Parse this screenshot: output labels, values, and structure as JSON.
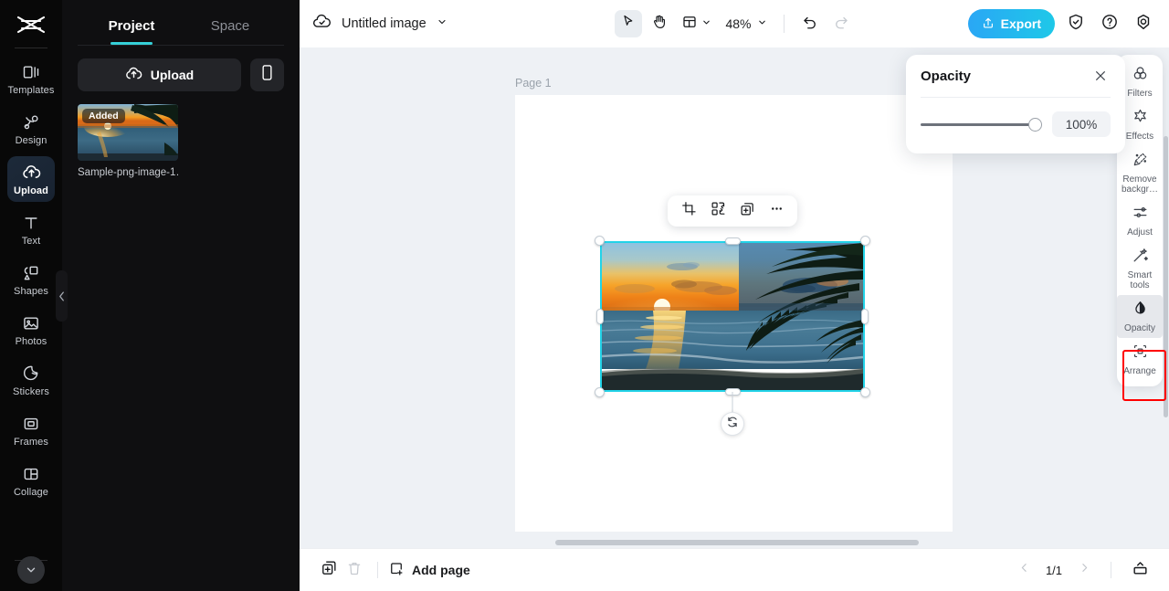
{
  "rail": {
    "logo_icon": "capcut-logo-icon",
    "items": [
      {
        "label": "Templates",
        "icon": "templates-icon",
        "active": false
      },
      {
        "label": "Design",
        "icon": "design-icon",
        "active": false
      },
      {
        "label": "Upload",
        "icon": "upload-cloud-icon",
        "active": true
      },
      {
        "label": "Text",
        "icon": "text-icon",
        "active": false
      },
      {
        "label": "Shapes",
        "icon": "shapes-icon",
        "active": false
      },
      {
        "label": "Photos",
        "icon": "photos-icon",
        "active": false
      },
      {
        "label": "Stickers",
        "icon": "stickers-icon",
        "active": false
      },
      {
        "label": "Frames",
        "icon": "frames-icon",
        "active": false
      },
      {
        "label": "Collage",
        "icon": "collage-icon",
        "active": false
      }
    ],
    "collapse_icon": "chevron-down-icon"
  },
  "panel": {
    "tabs": [
      {
        "label": "Project",
        "active": true
      },
      {
        "label": "Space",
        "active": false
      }
    ],
    "upload_label": "Upload",
    "upload_icon": "upload-cloud-icon",
    "mobile_icon": "mobile-phone-icon",
    "asset": {
      "badge": "Added",
      "name": "Sample-png-image-1…"
    },
    "collapse_handle_icon": "chevron-left-icon"
  },
  "topbar": {
    "cloud_icon": "cloud-check-icon",
    "doc_title": "Untitled image",
    "title_caret_icon": "chevron-down-icon",
    "select_tool_icon": "cursor-arrow-icon",
    "hand_tool_icon": "hand-icon",
    "layout_icon": "layout-panels-icon",
    "layout_caret_icon": "chevron-down-icon",
    "zoom_value": "48%",
    "zoom_caret_icon": "chevron-down-icon",
    "undo_icon": "undo-arrow-icon",
    "redo_icon": "redo-arrow-icon",
    "export_label": "Export",
    "export_icon": "share-upload-icon",
    "export_color": "#1ec3e6",
    "shield_icon": "shield-check-icon",
    "help_icon": "question-circle-icon",
    "settings_icon": "gear-icon"
  },
  "canvas": {
    "page_label": "Page 1",
    "background_color": "#eef1f5",
    "page_color": "#ffffff",
    "selection_color": "#22d3e8",
    "float_toolbar": [
      {
        "icon": "crop-icon",
        "name": "crop-button"
      },
      {
        "icon": "replace-icon",
        "name": "replace-button"
      },
      {
        "icon": "duplicate-add-icon",
        "name": "duplicate-button"
      },
      {
        "icon": "more-dots-icon",
        "name": "more-options-button"
      }
    ],
    "rotate_icon": "rotate-icon"
  },
  "opacity_popup": {
    "title": "Opacity",
    "close_icon": "close-x-icon",
    "value": "100%",
    "slider_percent": 100
  },
  "tools": {
    "items": [
      {
        "label": "Filters",
        "icon": "filters-circles-icon",
        "highlighted": false
      },
      {
        "label": "Effects",
        "icon": "effects-star-icon",
        "highlighted": false
      },
      {
        "label": "Remove backgr…",
        "icon": "remove-background-icon",
        "highlighted": false
      },
      {
        "label": "Adjust",
        "icon": "adjust-sliders-icon",
        "highlighted": false
      },
      {
        "label": "Smart tools",
        "icon": "smart-tools-wand-icon",
        "highlighted": false
      },
      {
        "label": "Opacity",
        "icon": "opacity-droplet-icon",
        "highlighted": true
      },
      {
        "label": "Arrange",
        "icon": "arrange-icon",
        "highlighted": false
      }
    ],
    "highlight_color": "#ff0000"
  },
  "annotation": {
    "arrow_color": "#ff0000",
    "points_to": "Opacity"
  },
  "bottombar": {
    "duplicate_page_icon": "duplicate-page-icon",
    "delete_page_icon": "trash-icon",
    "add_page_label": "Add page",
    "add_page_icon": "add-page-icon",
    "prev_icon": "chevron-left-icon",
    "page_indicator": "1/1",
    "next_icon": "chevron-right-icon",
    "present_icon": "present-icon"
  }
}
